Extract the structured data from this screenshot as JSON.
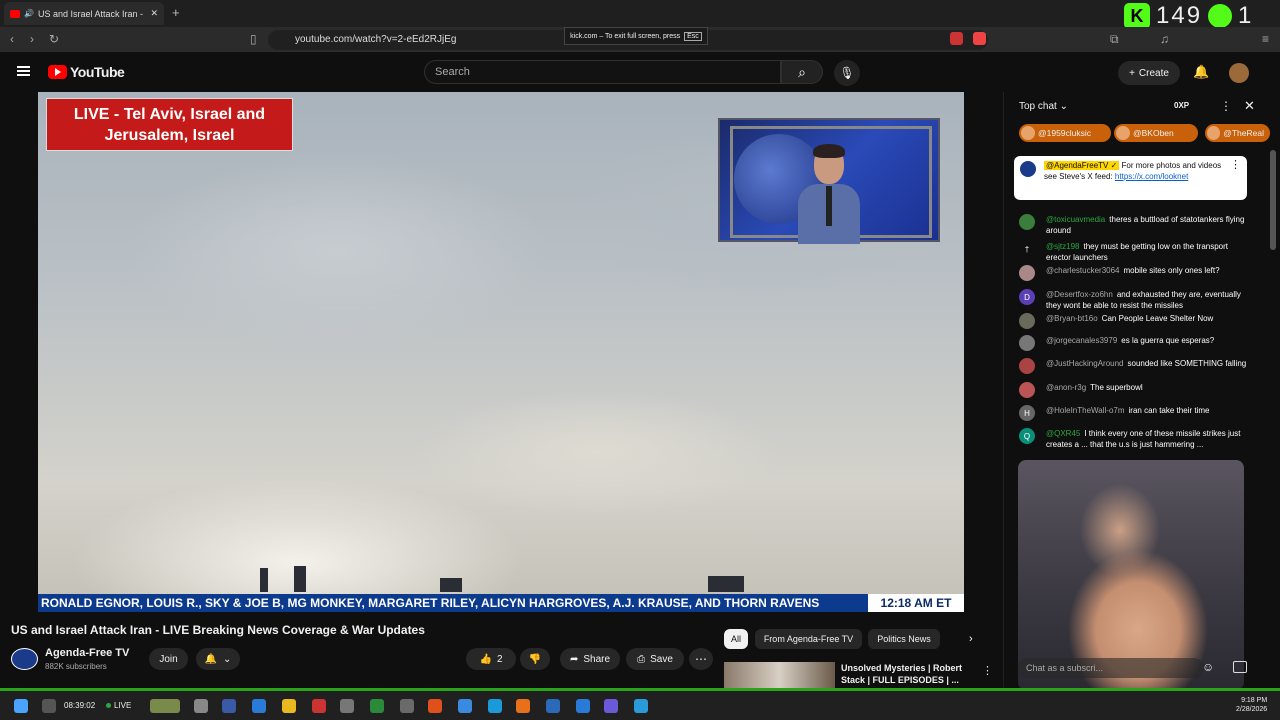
{
  "browser": {
    "tab_title": "US and Israel Attack Iran - LIVE",
    "url": "youtube.com/watch?v=2-eEd2RJjEg",
    "fullscreen_note": "kick.com – To exit full screen, press",
    "fullscreen_key": "Esc"
  },
  "kick": {
    "logo_letter": "K",
    "viewer_count": "149",
    "trailing": "1"
  },
  "youtube": {
    "logo_text": "YouTube",
    "search_placeholder": "Search",
    "create_label": "Create"
  },
  "video": {
    "live_overlay": "LIVE - Tel Aviv, Israel and Jerusalem, Israel",
    "ticker_text": "RONALD EGNOR, LOUIS R., SKY & JOE B, MG MONKEY, MARGARET RILEY, ALICYN HARGROVES, A.J. KRAUSE, AND THORN RAVENS",
    "ticker_time": "12:18 AM ET",
    "title": "US and Israel Attack Iran - LIVE Breaking News Coverage & War Updates"
  },
  "channel": {
    "name": "Agenda-Free TV",
    "subscribers": "882K subscribers",
    "join_label": "Join"
  },
  "actions": {
    "like_count": "2",
    "share_label": "Share",
    "save_label": "Save"
  },
  "chips": [
    "All",
    "From Agenda-Free TV",
    "Politics News"
  ],
  "recommendation": {
    "title": "Unsolved Mysteries | Robert Stack | FULL EPISODES | ..."
  },
  "chat": {
    "mode_label": "Top chat",
    "xp_label": "0XP",
    "badges": [
      "@1959cluksic",
      "@BKOben",
      "@TheReal"
    ],
    "pinned": {
      "author": "@AgendaFreeTV ✓",
      "text": "For more photos and videos see Steve's X feed:",
      "link": "https://x.com/looknet"
    },
    "messages": [
      {
        "author": "@toxicuavmedia",
        "text": "theres a buttload of statotankers flying around",
        "color": "#3b7d3b",
        "initial": ""
      },
      {
        "author": "@sjtz198",
        "text": "they must be getting low on the transport erector launchers",
        "color": "#0f0f0f",
        "initial": "†"
      },
      {
        "author": "@charlestucker3064",
        "text": "mobile sites only ones left?",
        "color": "#a88",
        "initial": ""
      },
      {
        "author": "@Desertfox-zo6hn",
        "text": "and exhausted they are, eventually they wont be able to resist the missiles",
        "color": "#5b3fb5",
        "initial": "D"
      },
      {
        "author": "@Bryan-bt16o",
        "text": "Can People Leave Shelter Now",
        "color": "#6a6a5a",
        "initial": ""
      },
      {
        "author": "@jorgecanales3979",
        "text": "es la guerra que esperas?",
        "color": "#777",
        "initial": ""
      },
      {
        "author": "@JustHackingAround",
        "text": "sounded like SOMETHING falling",
        "color": "#a44",
        "initial": ""
      },
      {
        "author": "@anon-r3g",
        "text": "The superbowl",
        "color": "#b55",
        "initial": ""
      },
      {
        "author": "@HoleInTheWall-o7m",
        "text": "iran can take their time",
        "color": "#666",
        "initial": "H"
      },
      {
        "author": "@QXR45",
        "text": "I think every one of these missile strikes just creates a ... that the u.s is just hammering ...",
        "color": "#0a8f7a",
        "initial": "Q"
      }
    ],
    "input_placeholder": "Chat as a subscri..."
  },
  "taskbar": {
    "timer": "08:39:02",
    "live": "LIVE",
    "clock_time": "9:18 PM",
    "clock_date": "2/28/2026"
  }
}
